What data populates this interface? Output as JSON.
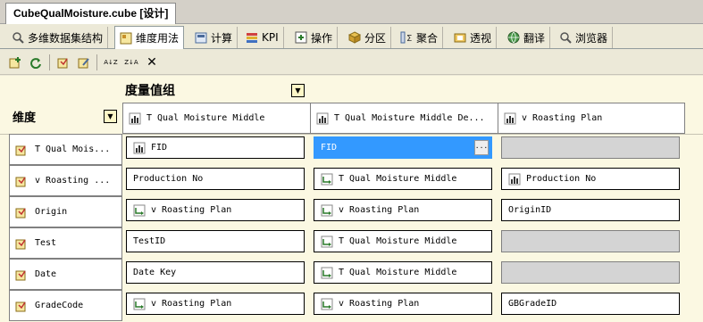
{
  "document_tab": {
    "title": "CubeQualMoisture.cube [设计]"
  },
  "designer_tabs": [
    {
      "label": "多维数据集结构",
      "icon": "cube-structure-icon"
    },
    {
      "label": "维度用法",
      "icon": "dimension-usage-icon"
    },
    {
      "label": "计算",
      "icon": "calculator-icon"
    },
    {
      "label": "KPI",
      "icon": "kpi-icon"
    },
    {
      "label": "操作",
      "icon": "actions-icon"
    },
    {
      "label": "分区",
      "icon": "partitions-icon"
    },
    {
      "label": "聚合",
      "icon": "aggregations-icon"
    },
    {
      "label": "透视",
      "icon": "perspectives-icon"
    },
    {
      "label": "翻译",
      "icon": "translations-icon"
    },
    {
      "label": "浏览器",
      "icon": "browser-icon"
    }
  ],
  "active_tab_index": 1,
  "toolbar": {
    "buttons": [
      "add-dimension-icon",
      "refresh-icon",
      "add-relationship-icon",
      "edit-icon",
      "sort-ascending-icon",
      "sort-descending-icon",
      "delete-icon"
    ],
    "sort_asc_glyph": "A↓Z",
    "sort_desc_glyph": "Z↓A",
    "delete_glyph": "✕"
  },
  "grid": {
    "measure_groups_label": "度量值组",
    "dimensions_label": "维度",
    "measure_groups": [
      "T Qual Moisture Middle",
      "T Qual Moisture Middle De...",
      "v Roasting Plan"
    ],
    "dimensions": [
      "T Qual Mois...",
      "v Roasting ...",
      "Origin",
      "Test",
      "Date",
      "GradeCode"
    ],
    "cells": [
      [
        {
          "text": "FID",
          "type": "fact"
        },
        {
          "text": "FID",
          "type": "selected"
        },
        {
          "text": "",
          "type": "empty"
        }
      ],
      [
        {
          "text": "Production No",
          "type": "regular"
        },
        {
          "text": "T Qual Moisture Middle",
          "type": "referenced"
        },
        {
          "text": "Production No",
          "type": "fact"
        }
      ],
      [
        {
          "text": "v Roasting Plan",
          "type": "referenced"
        },
        {
          "text": "v Roasting Plan",
          "type": "referenced"
        },
        {
          "text": "OriginID",
          "type": "regular"
        }
      ],
      [
        {
          "text": "TestID",
          "type": "regular"
        },
        {
          "text": "T Qual Moisture Middle",
          "type": "referenced"
        },
        {
          "text": "",
          "type": "empty"
        }
      ],
      [
        {
          "text": "Date Key",
          "type": "regular"
        },
        {
          "text": "T Qual Moisture Middle",
          "type": "referenced"
        },
        {
          "text": "",
          "type": "empty"
        }
      ],
      [
        {
          "text": "v Roasting Plan",
          "type": "referenced"
        },
        {
          "text": "v Roasting Plan",
          "type": "referenced"
        },
        {
          "text": "GBGradeID",
          "type": "regular"
        }
      ]
    ]
  },
  "colors": {
    "selected": "#3399ff",
    "grid_background": "#fbf8e2",
    "empty_cell": "#d4d4d4"
  }
}
